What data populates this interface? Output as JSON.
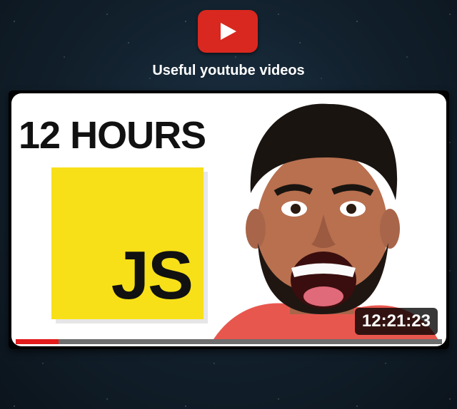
{
  "logo": {
    "icon": "youtube-play-icon",
    "color": "#d9281f"
  },
  "caption": "Useful youtube videos",
  "video": {
    "headline": "12 HOURS",
    "logo_text": "JS",
    "duration": "12:21:23",
    "progress": 0.1
  }
}
